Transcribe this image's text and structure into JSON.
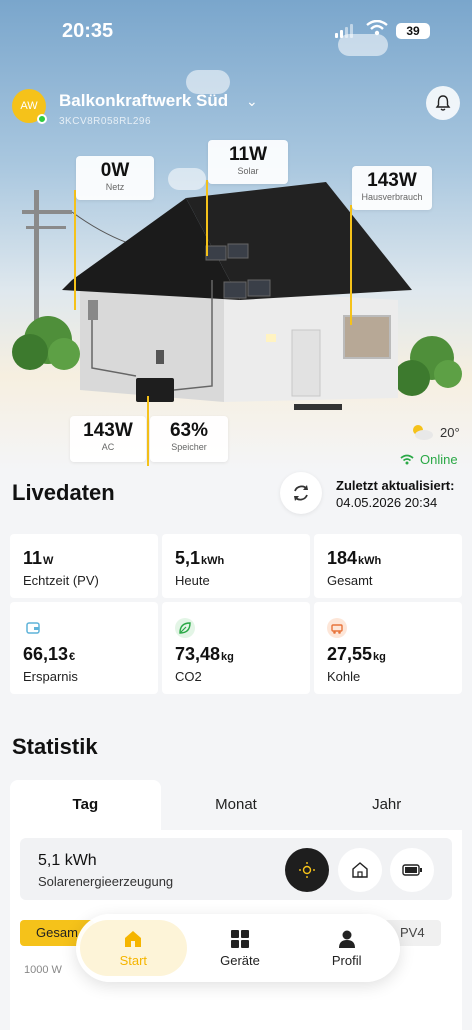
{
  "status": {
    "time": "20:35",
    "battery": "39"
  },
  "station": {
    "avatar": "AW",
    "name": "Balkonkraftwerk Süd",
    "id": "3KCV8R058RL296"
  },
  "flow": {
    "netz": {
      "value": "0W",
      "label": "Netz"
    },
    "solar": {
      "value": "11W",
      "label": "Solar"
    },
    "haus": {
      "value": "143W",
      "label": "Hausverbrauch"
    },
    "ac": {
      "value": "143W",
      "label": "AC"
    },
    "speicher": {
      "value": "63%",
      "label": "Speicher"
    }
  },
  "weather": {
    "temp": "20°",
    "status": "Online",
    "icon": "partly-cloudy-icon"
  },
  "live": {
    "title": "Livedaten",
    "updated_label": "Zuletzt aktualisiert:",
    "updated_value": "04.05.2026 20:34",
    "cells": [
      {
        "value": "11",
        "unit": "W",
        "label": "Echtzeit (PV)"
      },
      {
        "value": "5,1",
        "unit": "kWh",
        "label": "Heute"
      },
      {
        "value": "184",
        "unit": "kWh",
        "label": "Gesamt"
      },
      {
        "value": "66,13",
        "unit": "€",
        "label": "Ersparnis",
        "icon": "wallet-icon"
      },
      {
        "value": "73,48",
        "unit": "kg",
        "label": "CO2",
        "icon": "leaf-icon"
      },
      {
        "value": "27,55",
        "unit": "kg",
        "label": "Kohle",
        "icon": "coal-cart-icon"
      }
    ]
  },
  "stats": {
    "title": "Statistik",
    "tabs": [
      "Tag",
      "Monat",
      "Jahr"
    ],
    "energy_value": "5,1 kWh",
    "energy_label": "Solarenergieerzeugung",
    "chip_left": "Gesam",
    "chip_right": "PV4",
    "axis_top": "1000 W"
  },
  "nav": {
    "start": "Start",
    "devices": "Geräte",
    "profile": "Profil"
  },
  "colors": {
    "accent": "#f5c21a",
    "online": "#2aa846"
  }
}
